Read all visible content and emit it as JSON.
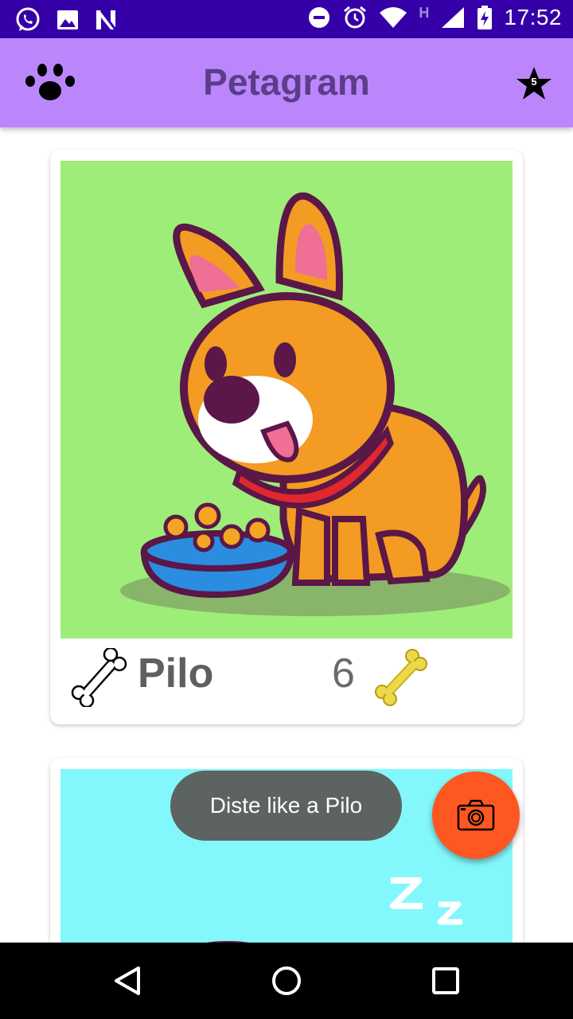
{
  "status_bar": {
    "time": "17:52",
    "network_label": "H",
    "icons": [
      "whatsapp-icon",
      "gallery-icon",
      "n-icon",
      "do-not-disturb-icon",
      "alarm-icon",
      "wifi-icon",
      "signal-icon",
      "battery-icon"
    ]
  },
  "app_bar": {
    "title": "Petagram",
    "left_icon": "paw-icon",
    "favorites_icon": "star-icon",
    "favorites_count": "5",
    "color": "#bb86fc",
    "title_color": "#5b3d8a"
  },
  "pets": [
    {
      "name": "Pilo",
      "likes": "6",
      "like_button_icon": "bone-outline-icon",
      "likes_icon": "bone-gold-icon",
      "photo_background": "#9eed78"
    },
    {
      "photo_background": "#83f8fc"
    }
  ],
  "toast": {
    "message": "Diste like a Pilo"
  },
  "fab": {
    "icon": "camera-icon",
    "color": "#ff5722"
  },
  "nav_bar": {
    "icons": [
      "back-icon",
      "home-icon",
      "recents-icon"
    ]
  }
}
